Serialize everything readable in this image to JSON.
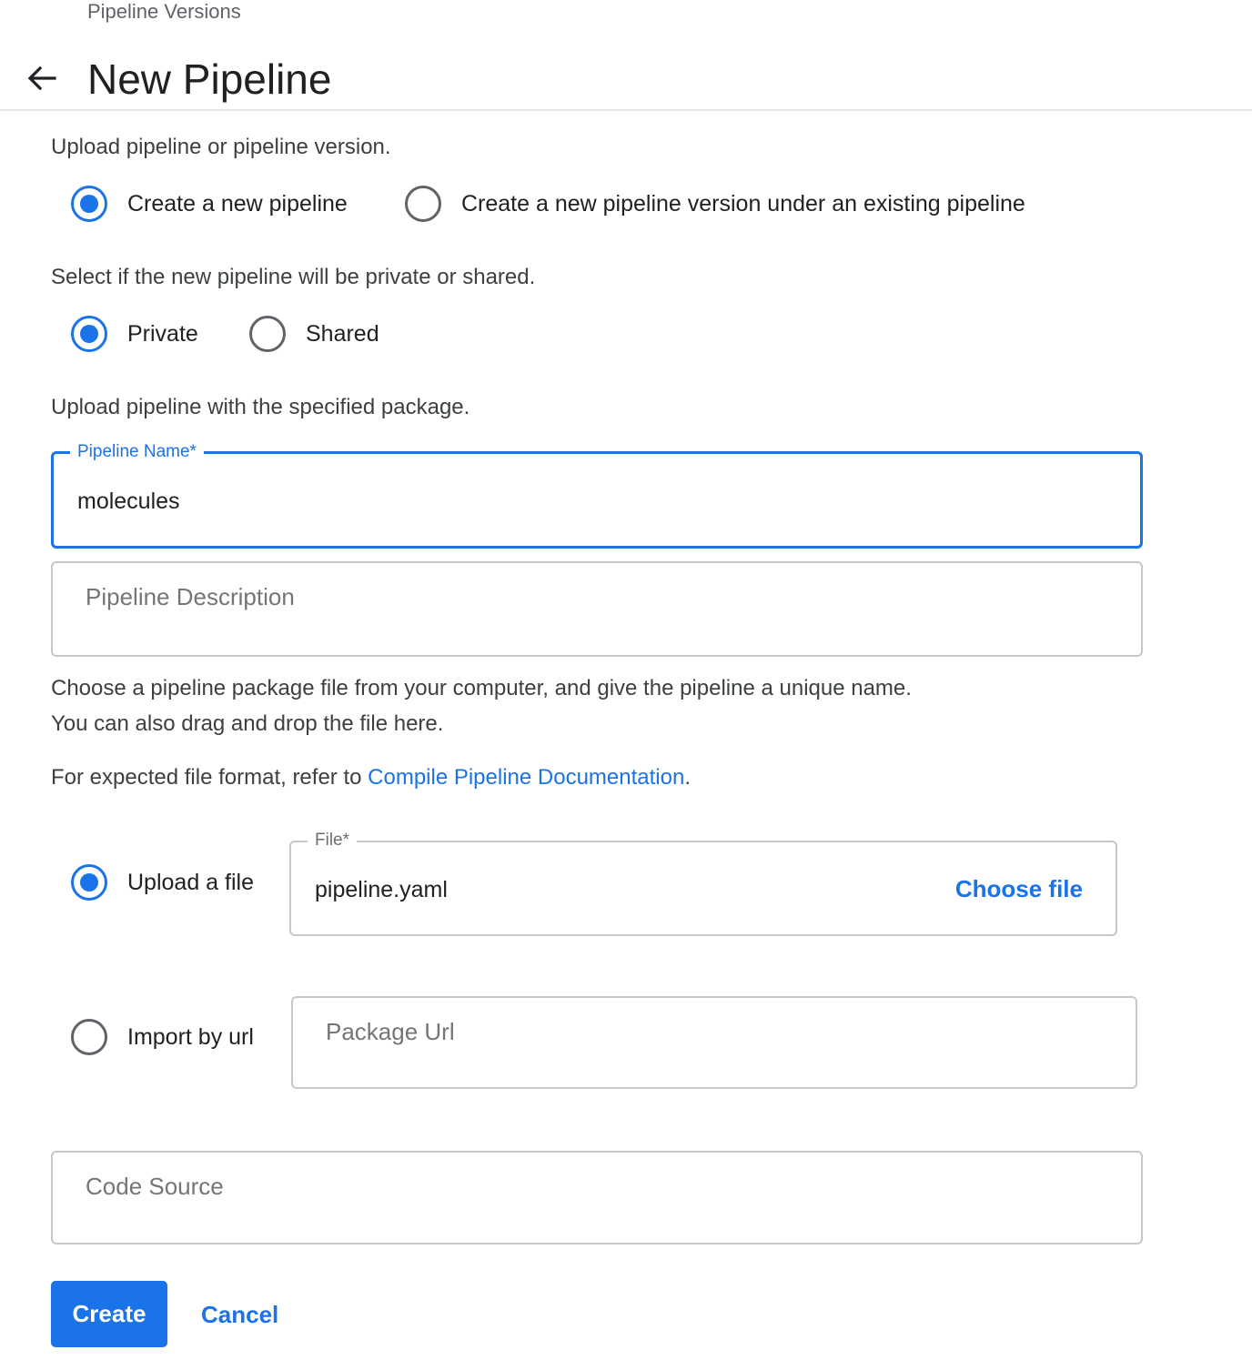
{
  "header": {
    "breadcrumb": "Pipeline Versions",
    "title": "New Pipeline",
    "back_icon": "arrow-left-icon"
  },
  "upload_type": {
    "prompt": "Upload pipeline or pipeline version.",
    "options": [
      {
        "label": "Create a new pipeline",
        "selected": true
      },
      {
        "label": "Create a new pipeline version under an existing pipeline",
        "selected": false
      }
    ]
  },
  "visibility": {
    "prompt": "Select if the new pipeline will be private or shared.",
    "options": [
      {
        "label": "Private",
        "selected": true
      },
      {
        "label": "Shared",
        "selected": false
      }
    ]
  },
  "package_prompt": "Upload pipeline with the specified package.",
  "pipeline_name": {
    "label": "Pipeline Name*",
    "value": "molecules"
  },
  "pipeline_description": {
    "placeholder": "Pipeline Description"
  },
  "instructions": {
    "line1": "Choose a pipeline package file from your computer, and give the pipeline a unique name.",
    "line2": "You can also drag and drop the file here.",
    "format_prefix": "For expected file format, refer to ",
    "format_link": "Compile Pipeline Documentation",
    "format_suffix": "."
  },
  "source": {
    "upload": {
      "label": "Upload a file",
      "selected": true,
      "field_label": "File*",
      "value": "pipeline.yaml",
      "button": "Choose file"
    },
    "url": {
      "label": "Import by url",
      "selected": false,
      "placeholder": "Package Url"
    }
  },
  "code_source": {
    "placeholder": "Code Source"
  },
  "actions": {
    "create": "Create",
    "cancel": "Cancel"
  },
  "colors": {
    "accent": "#1a73e8",
    "border": "#c7c7c7"
  }
}
